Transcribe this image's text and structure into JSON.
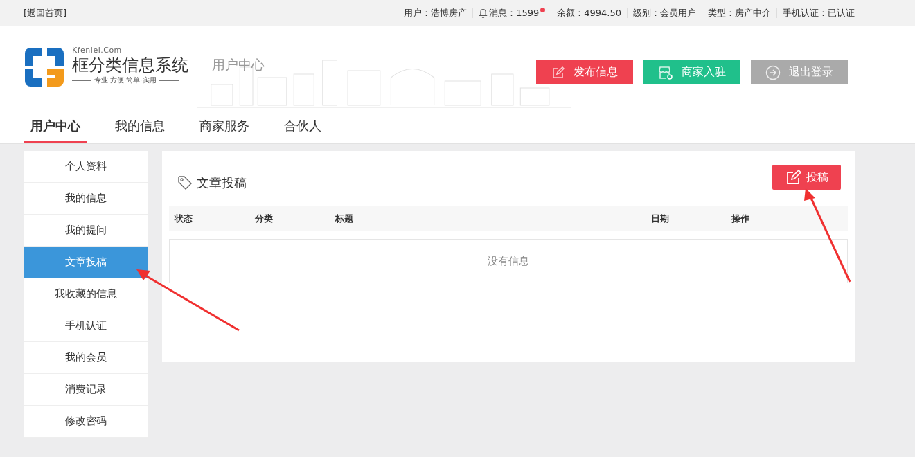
{
  "top_bar": {
    "home_link": "[返回首页]",
    "items": [
      {
        "kind": "text",
        "text": "用户：浩博房产"
      },
      {
        "kind": "messages",
        "text": "消息：1599",
        "unread": true
      },
      {
        "kind": "text",
        "text": "余额：4994.50"
      },
      {
        "kind": "text",
        "text": "级别：会员用户"
      },
      {
        "kind": "text",
        "text": "类型：房产中介"
      },
      {
        "kind": "text",
        "text": "手机认证：已认证"
      }
    ]
  },
  "header": {
    "logo": {
      "domain": "Kfenlei.Com",
      "name": "框分类信息系统",
      "slogan": "专业·方便·简单·实用"
    },
    "section": "用户中心",
    "buttons": [
      {
        "label": "发布信息",
        "kind": "publish"
      },
      {
        "label": "商家入驻",
        "kind": "merchant"
      },
      {
        "label": "退出登录",
        "kind": "logout"
      }
    ]
  },
  "nav": [
    {
      "label": "用户中心",
      "selected": true
    },
    {
      "label": "我的信息",
      "selected": false
    },
    {
      "label": "商家服务",
      "selected": false
    },
    {
      "label": "合伙人",
      "selected": false
    }
  ],
  "sidebar": {
    "items": [
      {
        "label": "个人资料",
        "selected": false
      },
      {
        "label": "我的信息",
        "selected": false
      },
      {
        "label": "我的提问",
        "selected": false
      },
      {
        "label": "文章投稿",
        "selected": true
      },
      {
        "label": "我收藏的信息",
        "selected": false
      },
      {
        "label": "手机认证",
        "selected": false
      },
      {
        "label": "我的会员",
        "selected": false
      },
      {
        "label": "消费记录",
        "selected": false
      },
      {
        "label": "修改密码",
        "selected": false
      }
    ]
  },
  "panel": {
    "title": "文章投稿",
    "button": "投稿",
    "table": {
      "columns": [
        "状态",
        "分类",
        "标题",
        "日期",
        "操作"
      ],
      "empty": "没有信息"
    }
  }
}
